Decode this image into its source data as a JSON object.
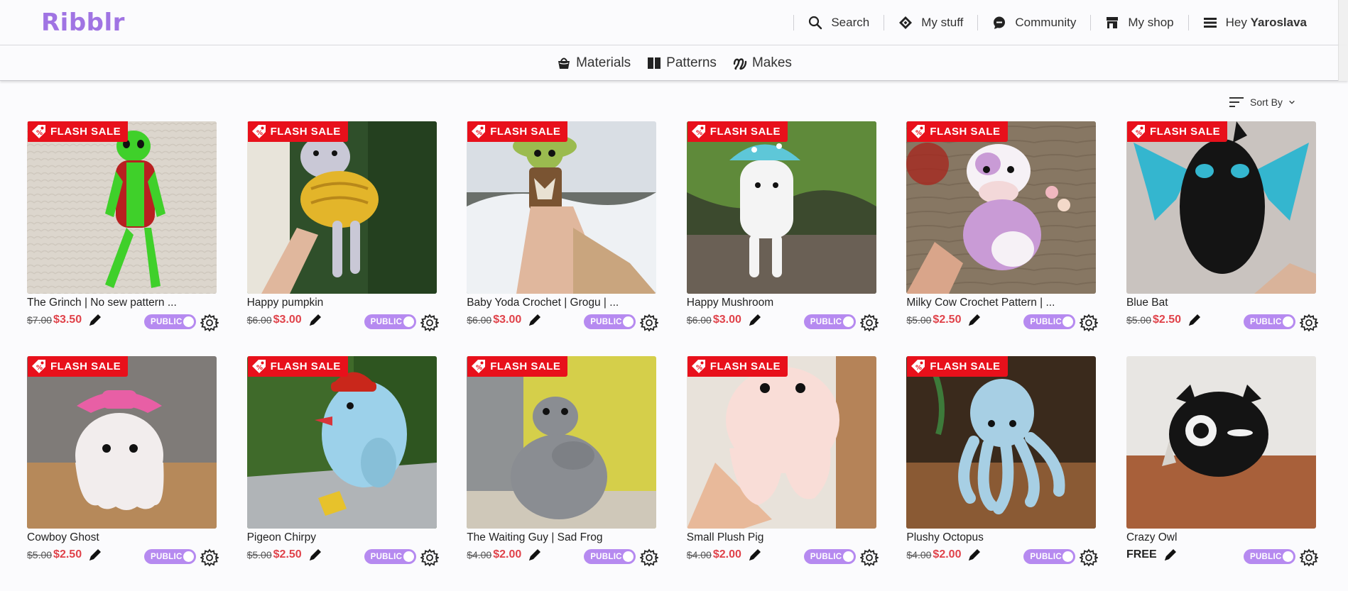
{
  "header": {
    "logo": "Ribblr",
    "nav": [
      {
        "label": "Search",
        "icon": "search-icon"
      },
      {
        "label": "My stuff",
        "icon": "diamond-icon"
      },
      {
        "label": "Community",
        "icon": "chat-bubble-icon"
      },
      {
        "label": "My shop",
        "icon": "shop-icon"
      }
    ],
    "greeting": "Hey",
    "user_name": "Yaroslava"
  },
  "subnav": [
    {
      "label": "Materials",
      "icon": "basket-icon"
    },
    {
      "label": "Patterns",
      "icon": "book-icon"
    },
    {
      "label": "Makes",
      "icon": "yarn-stitch-icon"
    }
  ],
  "sort": {
    "label": "Sort By",
    "icon": "sort-lines-icon"
  },
  "flash_label": "FLASH SALE",
  "visibility_label": "PUBLIC",
  "colors": {
    "brand": "#a074e3",
    "sale_red": "#e8101b",
    "price_red": "#e0424a",
    "toggle": "#b68af0"
  },
  "products": [
    {
      "title": "The Grinch | No sew pattern ...",
      "old_price": "$7.00",
      "price": "$3.50",
      "flash": true,
      "scene": "grinch"
    },
    {
      "title": "Happy pumpkin",
      "old_price": "$6.00",
      "price": "$3.00",
      "flash": true,
      "scene": "pumpkin"
    },
    {
      "title": "Baby Yoda Crochet | Grogu | ...",
      "old_price": "$6.00",
      "price": "$3.00",
      "flash": true,
      "scene": "yoda"
    },
    {
      "title": "Happy Mushroom",
      "old_price": "$6.00",
      "price": "$3.00",
      "flash": true,
      "scene": "mushroom"
    },
    {
      "title": "Milky Cow Crochet Pattern | ...",
      "old_price": "$5.00",
      "price": "$2.50",
      "flash": true,
      "scene": "cow"
    },
    {
      "title": "Blue Bat",
      "old_price": "$5.00",
      "price": "$2.50",
      "flash": true,
      "scene": "bat"
    },
    {
      "title": "Cowboy Ghost",
      "old_price": "$5.00",
      "price": "$2.50",
      "flash": true,
      "scene": "ghost"
    },
    {
      "title": "Pigeon Chirpy",
      "old_price": "$5.00",
      "price": "$2.50",
      "flash": true,
      "scene": "pigeon"
    },
    {
      "title": "The Waiting Guy | Sad Frog",
      "old_price": "$4.00",
      "price": "$2.00",
      "flash": true,
      "scene": "frog"
    },
    {
      "title": "Small Plush Pig",
      "old_price": "$4.00",
      "price": "$2.00",
      "flash": true,
      "scene": "pig"
    },
    {
      "title": "Plushy Octopus",
      "old_price": "$4.00",
      "price": "$2.00",
      "flash": true,
      "scene": "octopus"
    },
    {
      "title": "Crazy Owl",
      "old_price": "",
      "price": "FREE",
      "flash": false,
      "scene": "owl"
    }
  ]
}
